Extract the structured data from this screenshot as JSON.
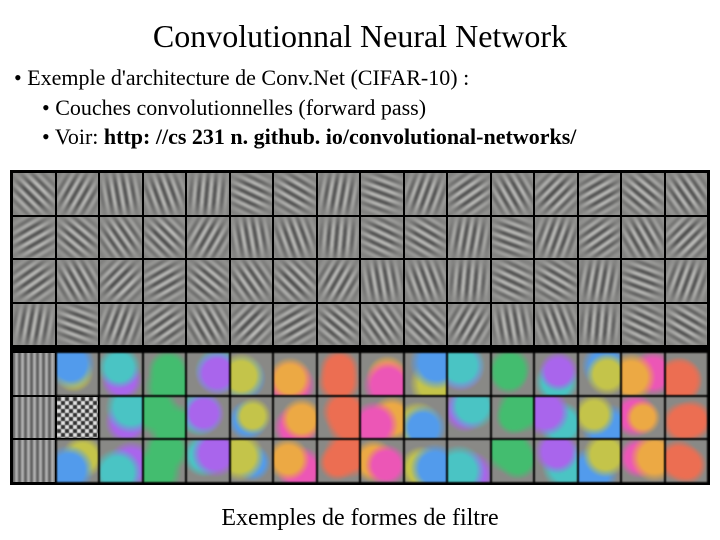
{
  "title": "Convolutionnal Neural Network",
  "bullets": {
    "l1": "Exemple d'architecture de Conv.Net  (CIFAR-10) :",
    "l2a": "Couches convolutionnelles (forward pass)",
    "l2b_prefix": "Voir: ",
    "l2b_link": "http: //cs 231 n. github. io/convolutional-networks/"
  },
  "caption": "Exemples de formes de filtre",
  "filters": {
    "upper": {
      "rows": 4,
      "cols": 16,
      "style": "gabor"
    },
    "lower": {
      "rows": 3,
      "cols": 16,
      "style": "colored"
    }
  }
}
